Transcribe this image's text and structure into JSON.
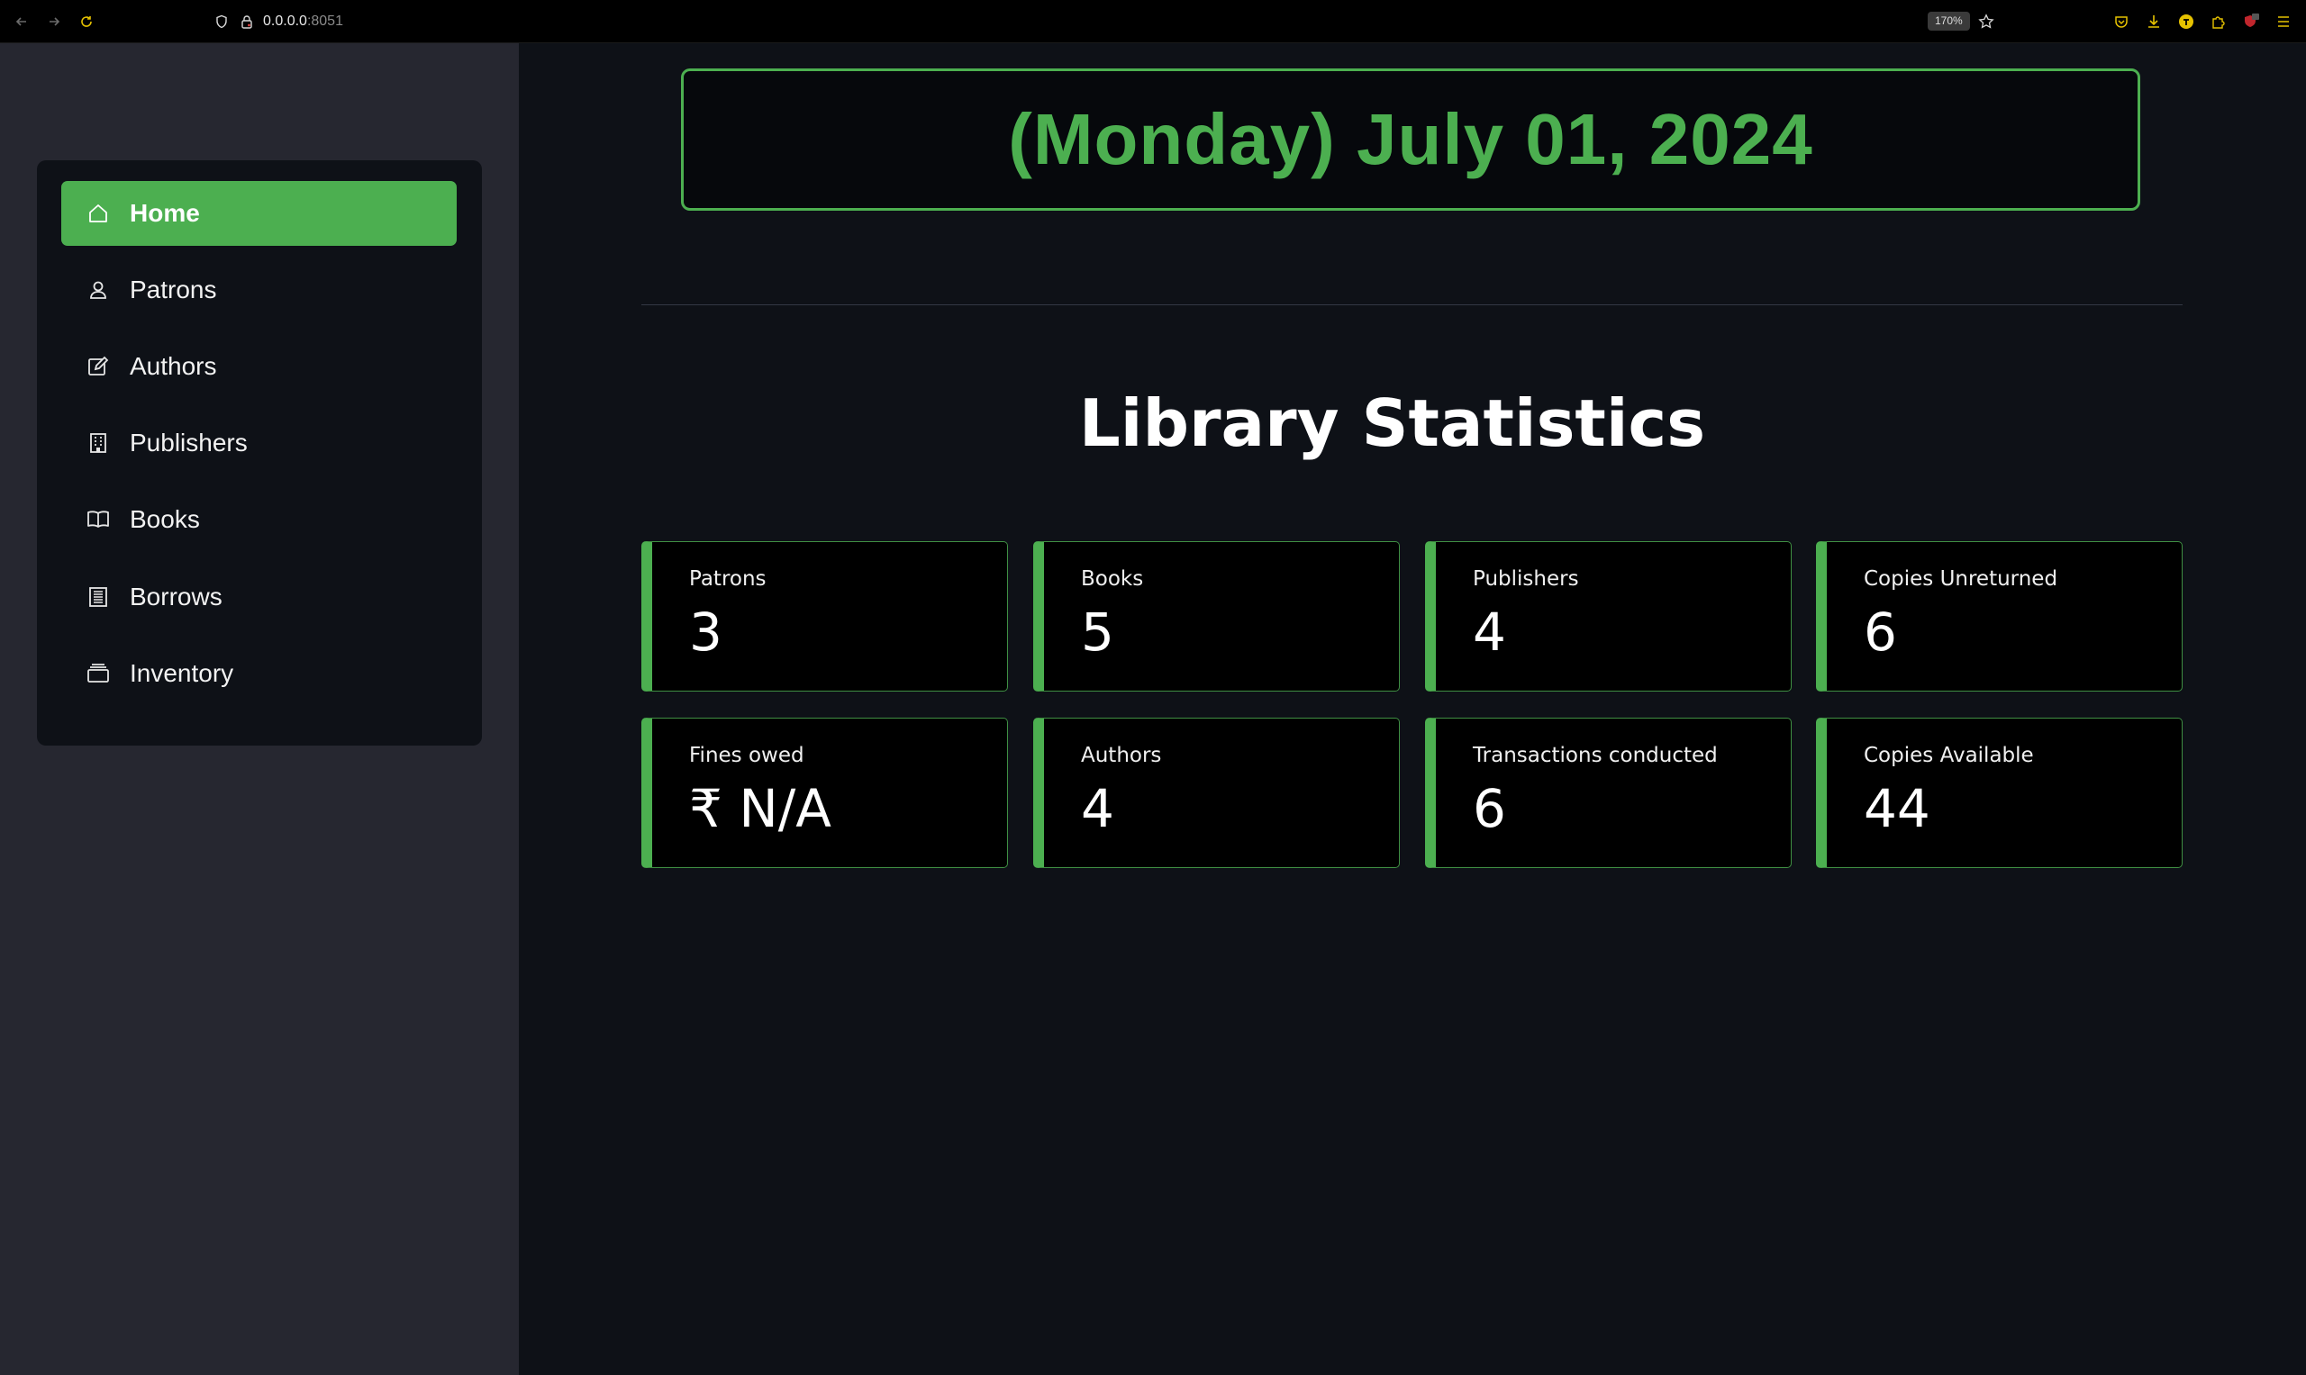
{
  "browser": {
    "url_host": "0.0.0.0",
    "url_port": ":8051",
    "zoom": "170%"
  },
  "sidebar": {
    "items": [
      {
        "label": "Home",
        "icon": "home-icon",
        "active": true
      },
      {
        "label": "Patrons",
        "icon": "person-icon",
        "active": false
      },
      {
        "label": "Authors",
        "icon": "edit-icon",
        "active": false
      },
      {
        "label": "Publishers",
        "icon": "building-icon",
        "active": false
      },
      {
        "label": "Books",
        "icon": "book-icon",
        "active": false
      },
      {
        "label": "Borrows",
        "icon": "receipt-icon",
        "active": false
      },
      {
        "label": "Inventory",
        "icon": "inventory-icon",
        "active": false
      }
    ]
  },
  "main": {
    "date": "(Monday) July 01, 2024",
    "title": "Library Statistics",
    "stats": [
      {
        "label": "Patrons",
        "value": "3"
      },
      {
        "label": "Books",
        "value": "5"
      },
      {
        "label": "Publishers",
        "value": "4"
      },
      {
        "label": "Copies Unreturned",
        "value": "6"
      },
      {
        "label": "Fines owed",
        "value": "₹ N/A"
      },
      {
        "label": "Authors",
        "value": "4"
      },
      {
        "label": "Transactions conducted",
        "value": "6"
      },
      {
        "label": "Copies Available",
        "value": "44"
      }
    ]
  },
  "colors": {
    "accent": "#4caf50",
    "background": "#0e1117",
    "sidebar": "#262730"
  }
}
